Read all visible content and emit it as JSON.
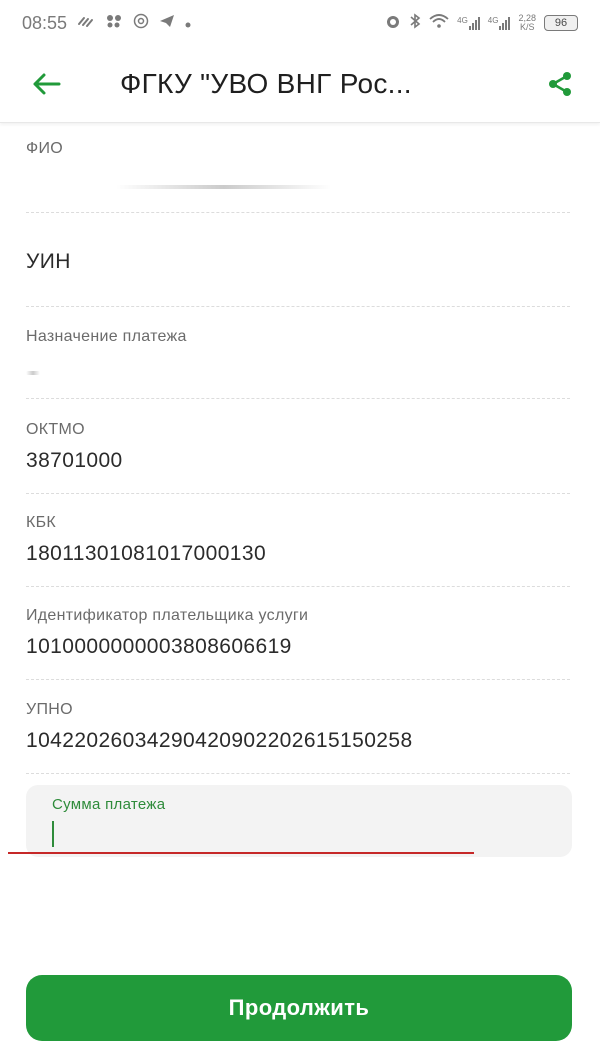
{
  "status_bar": {
    "time": "08:55",
    "network_speed": "2,28",
    "network_speed_unit": "K/S",
    "battery": "96",
    "network_type_1": "4G",
    "network_type_2": "4G"
  },
  "header": {
    "title": "ФГКУ \"УВО ВНГ Рос...",
    "accent_color": "#219a3a"
  },
  "fields": {
    "fio": {
      "label": "ФИО",
      "value": ""
    },
    "uin": {
      "label": "УИН"
    },
    "purpose": {
      "label": "Назначение платежа",
      "value": ""
    },
    "oktmo": {
      "label": "ОКТМО",
      "value": "38701000"
    },
    "kbk": {
      "label": "КБК",
      "value": "18011301081017000130"
    },
    "payer_id": {
      "label": "Идентификатор плательщика услуги",
      "value": "1010000000003808606619"
    },
    "upno": {
      "label": "УПНО",
      "value": "10422026034290420902202615150258"
    }
  },
  "sum_input": {
    "label": "Сумма платежа",
    "value": ""
  },
  "continue_button": {
    "label": "Продолжить"
  }
}
